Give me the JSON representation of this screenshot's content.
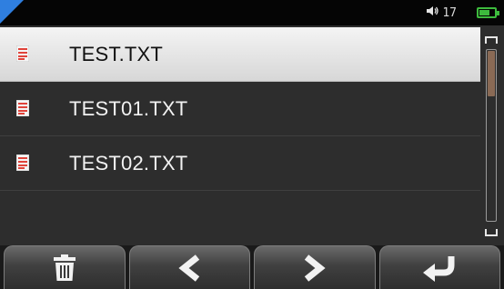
{
  "status": {
    "volume_icon": "speaker-icon",
    "volume_level": "17",
    "battery_icon": "battery-icon",
    "battery_level": 0.7,
    "battery_color": "#3dbb3d",
    "corner_color": "#2f7fe0"
  },
  "files": {
    "selected_index": 0,
    "items": [
      {
        "name": "TEST.TXT",
        "icon": "text-file-icon"
      },
      {
        "name": "TEST01.TXT",
        "icon": "text-file-icon"
      },
      {
        "name": "TEST02.TXT",
        "icon": "text-file-icon"
      }
    ]
  },
  "scroll": {
    "position": 0,
    "visible_fraction": 0.27
  },
  "toolbar": {
    "buttons": [
      {
        "action": "delete",
        "icon": "trash-icon"
      },
      {
        "action": "previous",
        "icon": "chevron-left-icon"
      },
      {
        "action": "next",
        "icon": "chevron-right-icon"
      },
      {
        "action": "back",
        "icon": "return-arrow-icon"
      }
    ]
  }
}
